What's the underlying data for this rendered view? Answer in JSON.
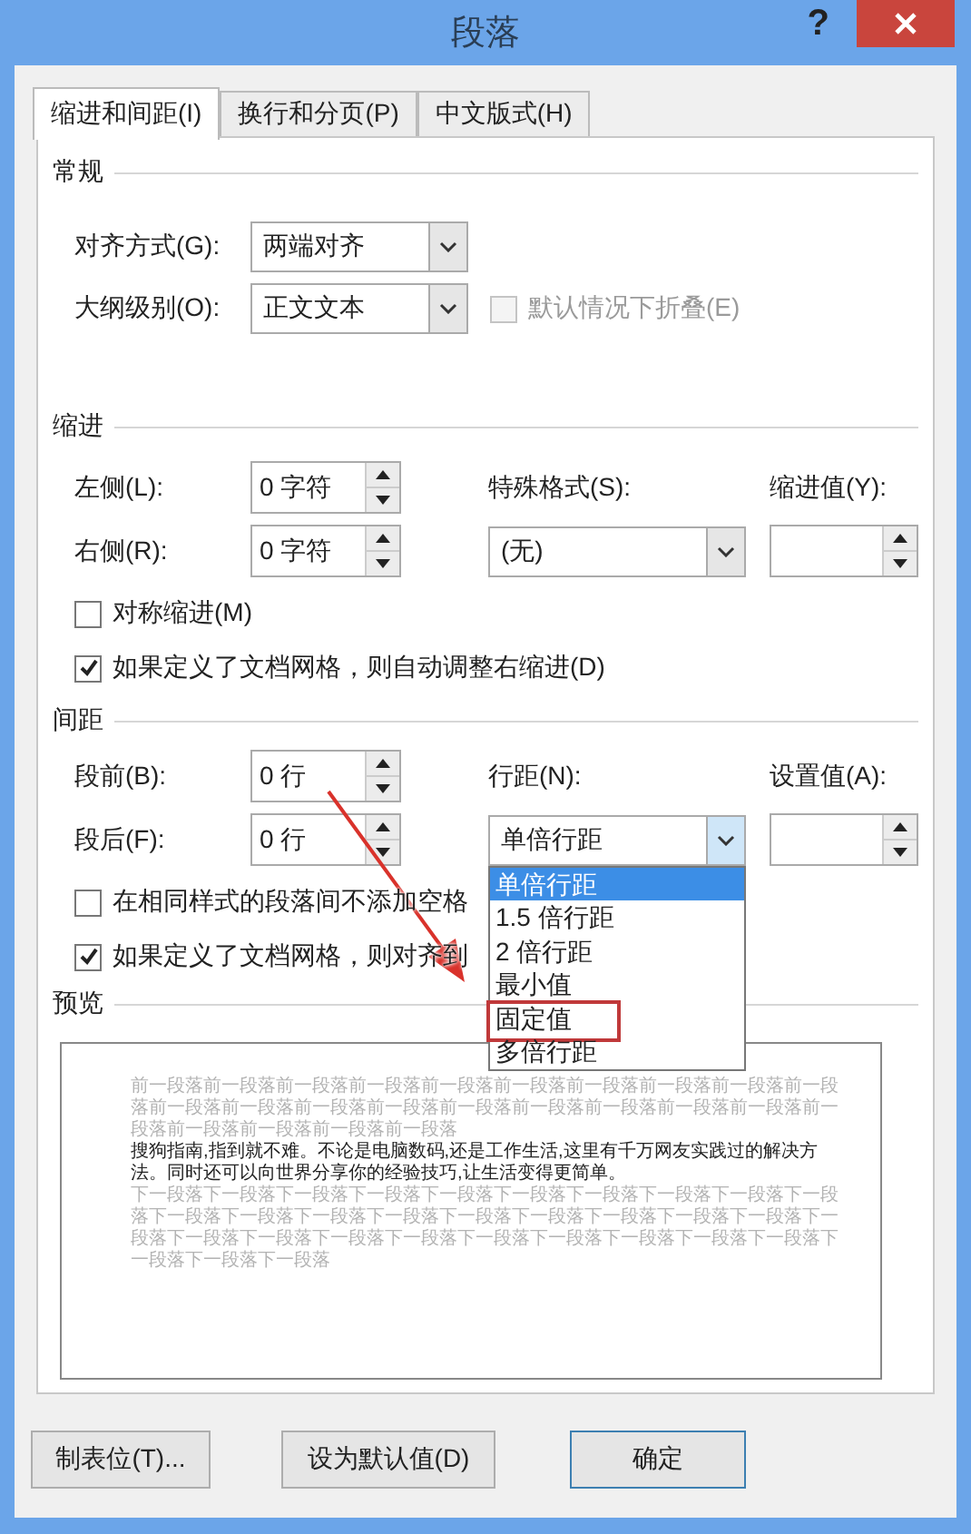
{
  "window": {
    "title": "段落",
    "help_button": "?"
  },
  "tabs": [
    {
      "label": "缩进和间距(I)",
      "selected": true
    },
    {
      "label": "换行和分页(P)",
      "selected": false
    },
    {
      "label": "中文版式(H)",
      "selected": false
    }
  ],
  "general": {
    "title": "常规",
    "alignment": {
      "label": "对齐方式(G):",
      "value": "两端对齐"
    },
    "outline_level": {
      "label": "大纲级别(O):",
      "value": "正文文本"
    },
    "collapse": {
      "label": "默认情况下折叠(E)",
      "checked": false,
      "disabled": true
    }
  },
  "indent": {
    "title": "缩进",
    "left": {
      "label": "左侧(L):",
      "value": "0 字符"
    },
    "right": {
      "label": "右侧(R):",
      "value": "0 字符"
    },
    "special": {
      "label": "特殊格式(S):",
      "value": "(无)"
    },
    "by": {
      "label": "缩进值(Y):"
    },
    "checkboxes": [
      {
        "label": "对称缩进(M)",
        "checked": false
      },
      {
        "label": "如果定义了文档网格，则自动调整右缩进(D)",
        "checked": true
      }
    ]
  },
  "spacing": {
    "title": "间距",
    "before": {
      "label": "段前(B):",
      "value": "0 行"
    },
    "after": {
      "label": "段后(F):",
      "value": "0 行"
    },
    "line_spacing": {
      "label": "行距(N):",
      "value": "单倍行距",
      "expanded": true,
      "options": [
        {
          "label": "单倍行距",
          "selected": true,
          "boxed": false
        },
        {
          "label": "1.5 倍行距",
          "selected": false,
          "boxed": false
        },
        {
          "label": "2 倍行距",
          "selected": false,
          "boxed": false
        },
        {
          "label": "最小值",
          "selected": false,
          "boxed": false
        },
        {
          "label": "固定值",
          "selected": false,
          "boxed": true
        },
        {
          "label": "多倍行距",
          "selected": false,
          "boxed": false
        }
      ]
    },
    "at": {
      "label": "设置值(A):"
    },
    "checkboxes": [
      {
        "label": "在相同样式的段落间不添加空格",
        "checked": false
      },
      {
        "label": "如果定义了文档网格，则对齐到",
        "checked": true
      }
    ]
  },
  "preview": {
    "title": "预览",
    "previous_text": "前一段落前一段落前一段落前一段落前一段落前一段落前一段落前一段落前一段落前一段落前一段落前一段落前一段落前一段落前一段落前一段落前一段落前一段落前一段落前一段落前一段落前一段落前一段落前一段落",
    "sample_text": "搜狗指南,指到就不难。不论是电脑数码,还是工作生活,这里有千万网友实践过的解决方法。同时还可以向世界分享你的经验技巧,让生活变得更简单。",
    "next_text": "下一段落下一段落下一段落下一段落下一段落下一段落下一段落下一段落下一段落下一段落下一段落下一段落下一段落下一段落下一段落下一段落下一段落下一段落下一段落下一段落下一段落下一段落下一段落下一段落下一段落下一段落下一段落下一段落下一段落下一段落下一段落下一段落"
  },
  "buttons": [
    {
      "label": "制表位(T)..."
    },
    {
      "label": "设为默认值(D)"
    },
    {
      "label": "确定"
    }
  ],
  "annotation": {
    "arrow": true
  }
}
